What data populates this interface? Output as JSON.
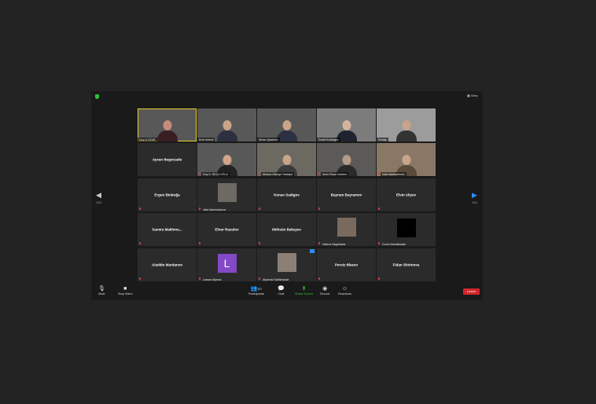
{
  "toolbar_top": {
    "view_label": "View"
  },
  "nav": {
    "left_page": "1/24",
    "right_page": "1/24"
  },
  "tiles": [
    {
      "name": "Doç.S.OTAR"
    },
    {
      "name": "Emil Aslanli"
    },
    {
      "name": "Ilkhan Qasimov"
    },
    {
      "name": "Dovid Kurbagov"
    },
    {
      "name": "Gunay"
    },
    {
      "name": "Ayxan Əsgərzadə"
    },
    {
      "name": "Doç.S. SEÇİLOĞLU"
    },
    {
      "name": "Aidəna Hüseyn Sadiqov"
    },
    {
      "name": "Amin Reza Vahidov"
    },
    {
      "name": "Nabi Alakbərlenisi"
    },
    {
      "name": "Ergun Binboğa"
    },
    {
      "name": "Vafa Mammadova"
    },
    {
      "name": "Kenan Sadigov"
    },
    {
      "name": "Bayram Bayramov"
    },
    {
      "name": "Elvin Aliyev"
    },
    {
      "name": "Samira  Makhmu..."
    },
    {
      "name": "Elnur Rasulov"
    },
    {
      "name": "Möhsün Bakayev"
    },
    {
      "name": "Sabina Naghizada"
    },
    {
      "name": "Gunel Abdullazade"
    },
    {
      "name": "Aladdin Mardanov"
    },
    {
      "name": "Laman Aliyeva"
    },
    {
      "name": "Aliyevad Sadikhzade"
    },
    {
      "name": "Perviz Ələzov"
    },
    {
      "name": "Fidan Shirinova"
    }
  ],
  "controls": {
    "mute": "Mute",
    "stop_video": "Stop Video",
    "participants": "Participants",
    "participants_count": "337",
    "chat": "Chat",
    "share_screen": "Share Screen",
    "record": "Record",
    "reactions": "Reactions",
    "leave": "Leave"
  },
  "avatar_letter": "L",
  "colors": {
    "accent": "#2d8cff",
    "active_speaker": "#e7d12a",
    "leave": "#d0252b",
    "share": "#2fbf3a"
  }
}
